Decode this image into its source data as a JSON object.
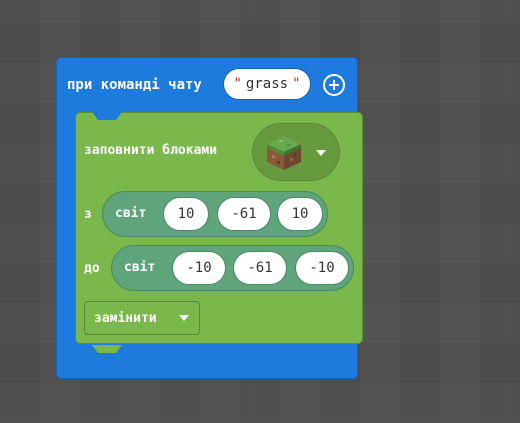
{
  "event": {
    "title": "при команді чату",
    "command_value": "grass",
    "quote_open": "\"",
    "quote_close": "\""
  },
  "fill": {
    "label": "заповнити блоками",
    "block_icon": "grass-block-icon",
    "from_label": "з",
    "to_label": "до",
    "from": {
      "world_label": "світ",
      "x": "10",
      "y": "-61",
      "z": "10"
    },
    "to": {
      "world_label": "світ",
      "x": "-10",
      "y": "-61",
      "z": "-10"
    },
    "mode": "замінити"
  },
  "colors": {
    "event_block": "#1e7bdd",
    "fill_block": "#7ab84c",
    "world_pos": "#5fa47a",
    "background": "#4a4a4a"
  }
}
